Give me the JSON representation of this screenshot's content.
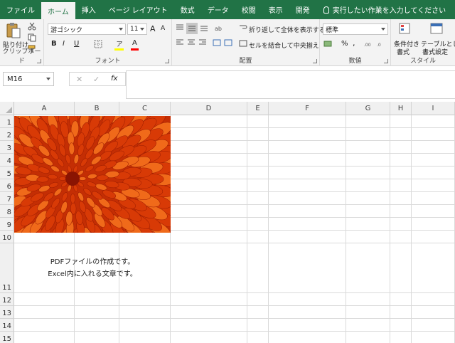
{
  "ribbon_tabs": [
    "ファイル",
    "ホーム",
    "挿入",
    "ページ レイアウト",
    "数式",
    "データ",
    "校閲",
    "表示",
    "開発"
  ],
  "active_tab": "ホーム",
  "tell_me": "実行したい作業を入力してください",
  "clipboard": {
    "paste_label": "貼り付け",
    "group_label": "クリップボード"
  },
  "font": {
    "name": "游ゴシック",
    "size": "11",
    "grow": "A",
    "shrink": "A",
    "bold": "B",
    "italic": "I",
    "underline": "U",
    "color_glyph": "A",
    "highlight_glyph": "ア",
    "group_label": "フォント",
    "color_bar": "#ff0000",
    "highlight_bar": "#ffff00"
  },
  "alignment": {
    "wrap_label": "折り返して全体を表示する",
    "merge_label": "セルを結合して中央揃え",
    "group_label": "配置"
  },
  "number": {
    "format": "標準",
    "percent": "%",
    "comma": ",",
    "group_label": "数値"
  },
  "styles": {
    "conditional_label": "条件付き",
    "conditional_label2": "書式",
    "table_label": "テーブルとして",
    "table_label2": "書式設定",
    "group_label": "スタイル"
  },
  "formula_bar": {
    "name_box": "M16",
    "fx": "fx",
    "value": ""
  },
  "columns": [
    "A",
    "B",
    "C",
    "D",
    "E",
    "F",
    "G",
    "H",
    "I"
  ],
  "rows": [
    "1",
    "2",
    "3",
    "4",
    "5",
    "6",
    "7",
    "8",
    "9",
    "10",
    "11",
    "12",
    "13",
    "14",
    "15"
  ],
  "cell_text": {
    "line1": "PDFファイルの作成です。",
    "line2": "Excel内に入れる文章です。"
  },
  "picture": {
    "description": "orange chrysanthemum flower photo",
    "colors": [
      "#d83a06",
      "#f06a1a",
      "#8a1402"
    ]
  }
}
